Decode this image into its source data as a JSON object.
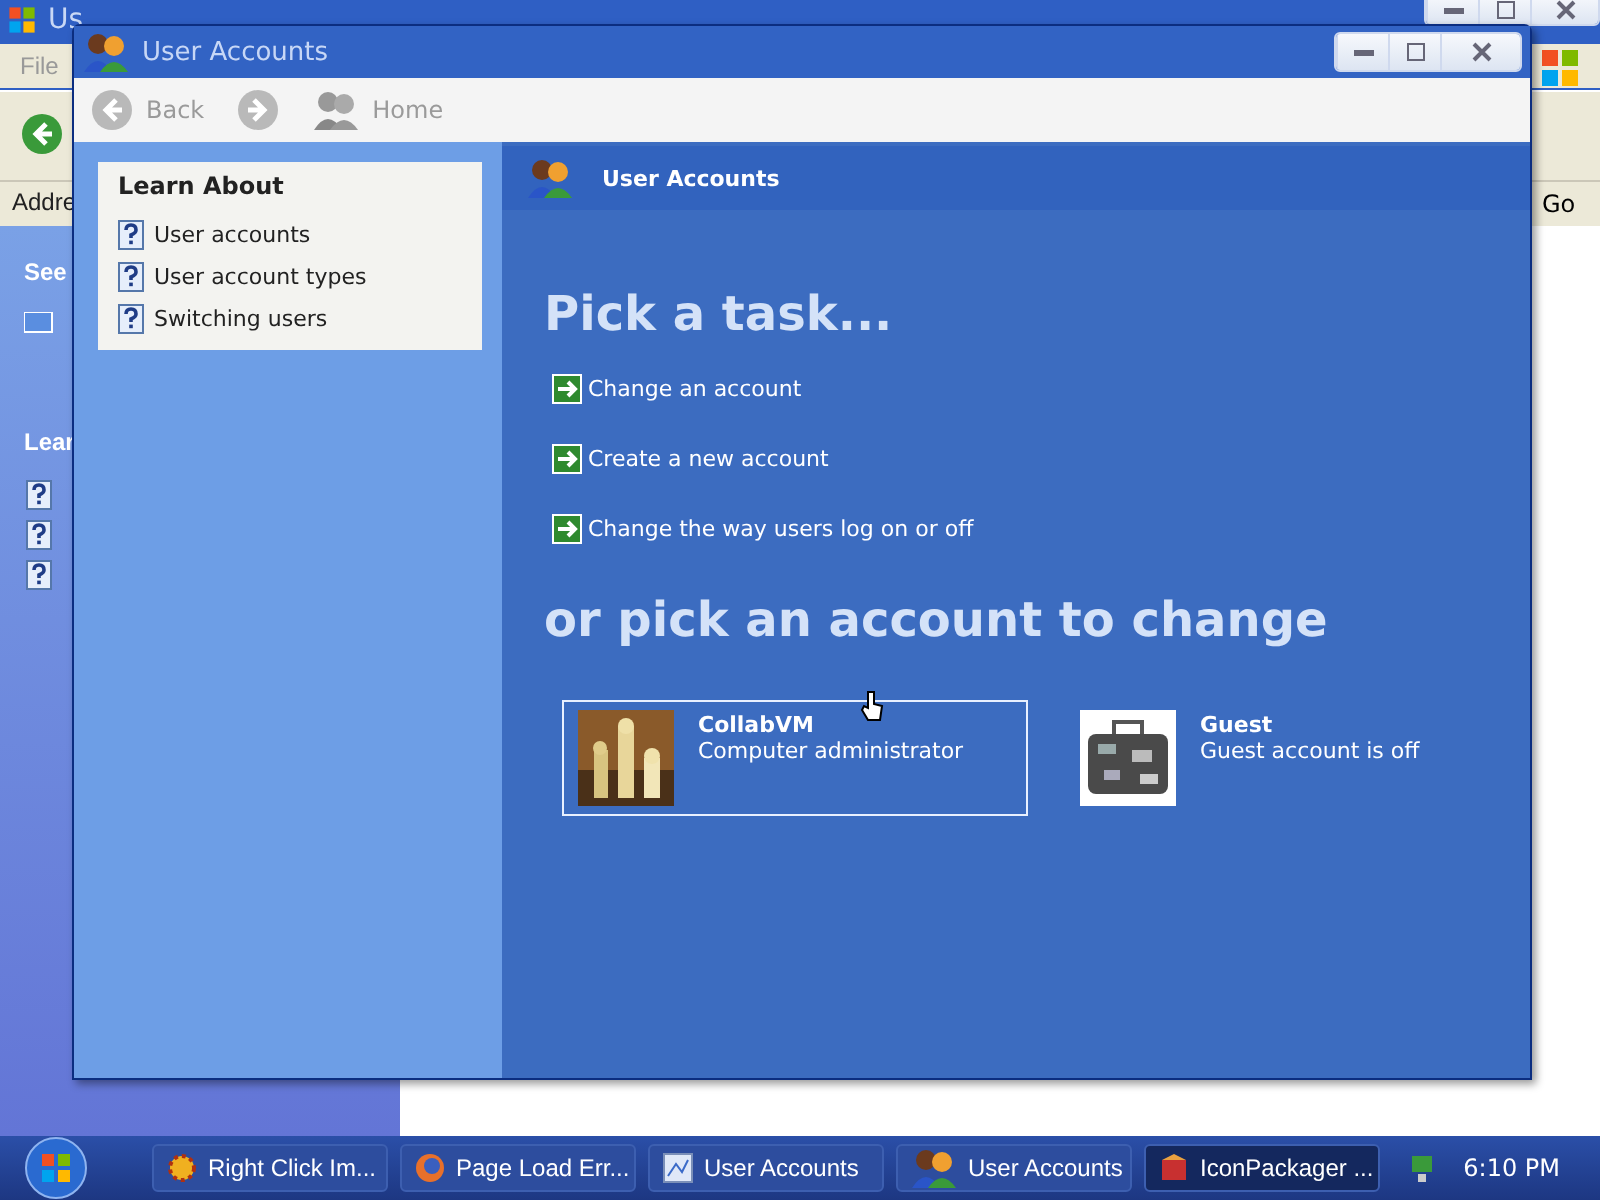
{
  "background_window": {
    "title": "Us",
    "menu": [
      "File"
    ],
    "address_label": "Addre",
    "go_button": "Go",
    "sidebar_headings": [
      "See",
      "Lear"
    ]
  },
  "window": {
    "title": "User Accounts",
    "toolbar": [
      {
        "kind": "back",
        "label": "Back",
        "disabled": true
      },
      {
        "kind": "forward",
        "disabled": true
      },
      {
        "kind": "home",
        "label": "Home",
        "disabled": true
      }
    ],
    "learn_about": {
      "title": "Learn About",
      "items": [
        "User accounts",
        "User account types",
        "Switching users"
      ]
    },
    "header": "User Accounts",
    "task_heading": "Pick a task...",
    "tasks": [
      "Change an account",
      "Create a new account",
      "Change the way users log on or off"
    ],
    "accounts_heading": "or pick an account to change",
    "accounts": [
      {
        "kind": "picture",
        "name": "CollabVM",
        "description": "Computer administrator",
        "selected": true
      },
      {
        "kind": "suitcase",
        "name": "Guest",
        "description": "Guest account is off",
        "selected": false
      }
    ]
  },
  "taskbar": {
    "items": [
      {
        "kind": "gear",
        "label": "Right Click Im...",
        "selected": false
      },
      {
        "kind": "globe",
        "label": "Page Load Err...",
        "selected": false
      },
      {
        "kind": "panel",
        "label": "User Accounts",
        "selected": false
      },
      {
        "kind": "users",
        "label": "User Accounts",
        "selected": false
      },
      {
        "kind": "box",
        "label": "IconPackager ...",
        "selected": true
      }
    ],
    "clock": "6:10 PM"
  }
}
